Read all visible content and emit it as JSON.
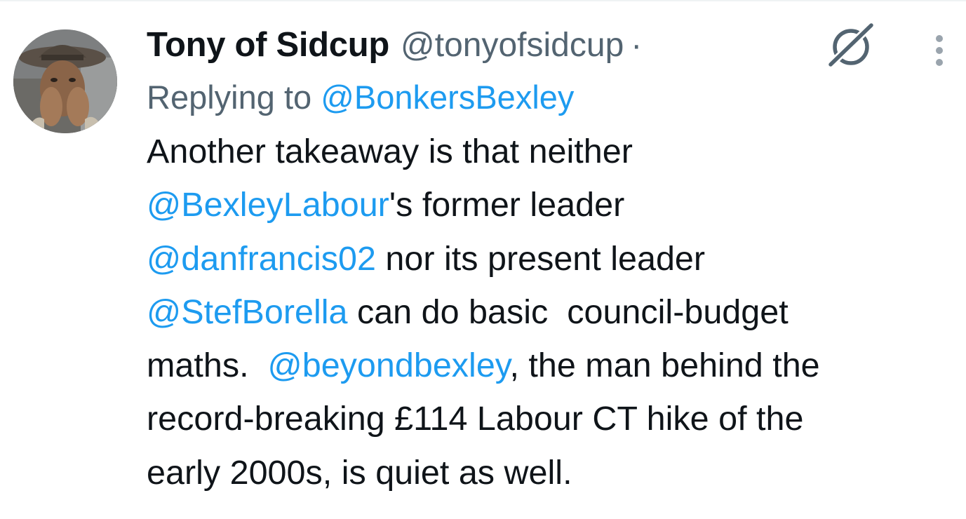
{
  "tweet": {
    "author": {
      "display_name": "Tony of Sidcup",
      "handle": "@tonyofsidcup",
      "separator": "·"
    },
    "reply": {
      "prefix": "Replying to ",
      "to_handle": "@BonkersBexley"
    },
    "text": {
      "line1": {
        "t1": "Another takeaway is that neither"
      },
      "line2": {
        "mention": "@BexleyLabour",
        "t1": "'s former leader"
      },
      "line3": {
        "mention": "@danfrancis02",
        "t1": " nor its present leader"
      },
      "line4": {
        "mention": "@StefBorella",
        "t1": " can do basic  council-budget"
      },
      "line5": {
        "t0": "maths.  ",
        "mention": "@beyondbexley",
        "t1": ", the man behind the"
      },
      "line6": {
        "t1": "record-breaking £114 Labour CT hike of the"
      },
      "line7": {
        "t1": "early 2000s, is quiet as well."
      }
    }
  },
  "icons": {
    "grok": "grok-icon",
    "more": "more-vertical-icon",
    "avatar": "profile-photo"
  },
  "colors": {
    "link": "#1d9bf0",
    "secondary_text": "#536471",
    "primary_text": "#0f1419",
    "divider": "#eff3f4"
  }
}
